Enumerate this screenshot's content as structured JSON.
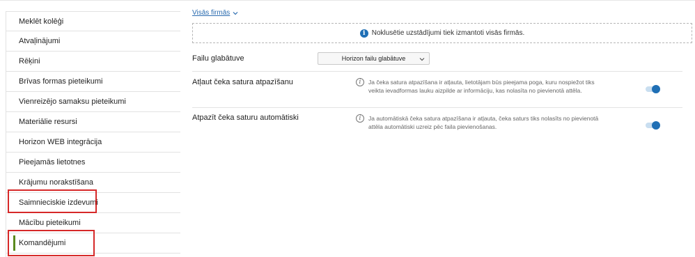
{
  "sidebar": {
    "items": [
      {
        "label": "Meklēt kolēģi"
      },
      {
        "label": "Atvaļinājumi"
      },
      {
        "label": "Rēķini"
      },
      {
        "label": "Brīvas formas pieteikumi"
      },
      {
        "label": "Vienreizējo samaksu pieteikumi"
      },
      {
        "label": "Materiālie resursi"
      },
      {
        "label": "Horizon WEB integrācija"
      },
      {
        "label": "Pieejamās lietotnes"
      },
      {
        "label": "Krājumu norakstīšana"
      },
      {
        "label": "Saimnieciskie izdevumi"
      },
      {
        "label": "Mācību pieteikumi"
      },
      {
        "label": "Komandējumi",
        "active": true
      }
    ]
  },
  "main": {
    "scope": {
      "label": "Visās firmās",
      "icon": "chevron-down-icon"
    },
    "notice": {
      "icon": "info-icon",
      "text": "Noklusētie uzstādījumi tiek izmantoti visās firmās."
    },
    "settings": [
      {
        "label": "Failu glabātuve",
        "control": "select",
        "value": "Horizon failu glabātuve"
      },
      {
        "label": "Atļaut čeka satura atpazīšanu",
        "control": "toggle",
        "enabled": true,
        "icon": "info-outline-icon",
        "description": "Ja čeka satura atpazīšana ir atļauta, lietotājam būs pieejama poga, kuru nospiežot tiks veikta ievadformas lauku aizpilde ar informāciju, kas nolasīta no pievienotā attēla."
      },
      {
        "label": "Atpazīt čeka saturu automātiski",
        "control": "toggle",
        "enabled": true,
        "icon": "info-outline-icon",
        "description": "Ja automātiskā čeka satura atpazīšana ir atļauta, čeka saturs tiks nolasīts no pievienotā attēla automātiski uzreiz pēc faila pievienošanas."
      }
    ]
  },
  "colors": {
    "accent": "#1f6fb5",
    "active_marker": "#5a8a1e",
    "highlight_box": "#d62828"
  }
}
